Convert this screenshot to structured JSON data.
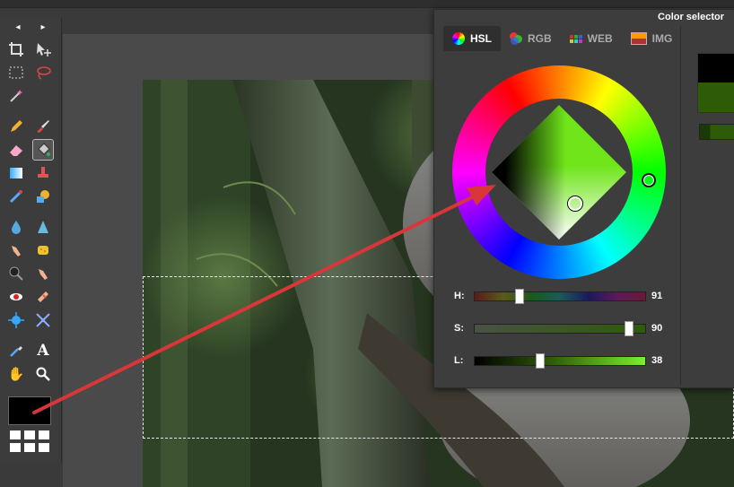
{
  "toolbox": {
    "nav_left": "◂",
    "nav_right": "▸",
    "active_tool": "paint-bucket",
    "primary_color": "#000000"
  },
  "color_selector": {
    "title": "Color selector",
    "tabs": [
      {
        "label": "HSL",
        "icon": "color-wheel-icon",
        "active": true
      },
      {
        "label": "RGB",
        "icon": "rgb-circles-icon",
        "active": false
      },
      {
        "label": "WEB",
        "icon": "web-palette-icon",
        "active": false
      },
      {
        "label": "IMG",
        "icon": "image-icon",
        "active": false
      }
    ],
    "sliders": [
      {
        "label": "H:",
        "value": "91",
        "fraction": 0.26
      },
      {
        "label": "S:",
        "value": "90",
        "fraction": 0.9
      },
      {
        "label": "L:",
        "value": "38",
        "fraction": 0.38
      }
    ],
    "previous_color": "#000000",
    "new_color": "#2e5b08"
  },
  "annotation": {
    "arrow_color": "#d9363a"
  }
}
